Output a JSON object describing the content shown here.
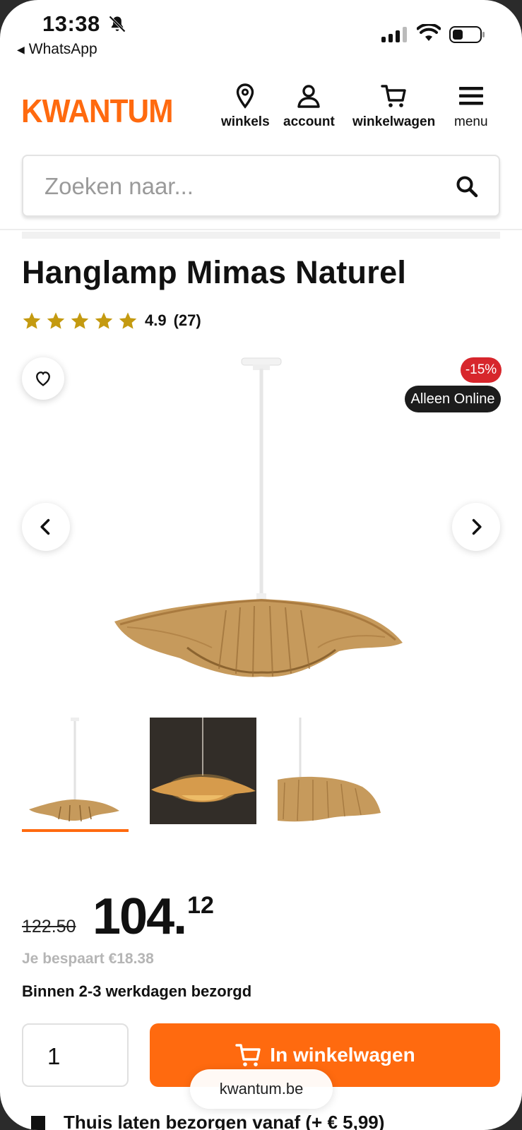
{
  "status_bar": {
    "time": "13:38",
    "back_app": "WhatsApp",
    "icons": [
      "bell-off-icon",
      "signal-icon",
      "wifi-icon",
      "battery-icon"
    ]
  },
  "header": {
    "logo": "KWANTUM",
    "nav": [
      {
        "label": "winkels",
        "icon": "location-pin-icon"
      },
      {
        "label": "account",
        "icon": "user-icon"
      },
      {
        "label": "winkelwagen",
        "icon": "cart-icon"
      },
      {
        "label": "menu",
        "icon": "hamburger-icon"
      }
    ]
  },
  "search": {
    "placeholder": "Zoeken naar..."
  },
  "product": {
    "title": "Hanglamp Mimas Naturel",
    "rating": {
      "score": "4.9",
      "count": "(27)",
      "stars": 5
    },
    "badges": {
      "discount": "-15%",
      "online": "Alleen Online"
    },
    "thumbnails": 3,
    "active_thumbnail": 0
  },
  "pricing": {
    "old_price": "122.50",
    "price_main": "104.",
    "price_cents": "12",
    "savings": "Je bespaart €18.38",
    "delivery": "Binnen 2-3 werkdagen bezorgd"
  },
  "purchase": {
    "quantity": "1",
    "cart_button": "In winkelwagen",
    "home_delivery": "Thuis laten bezorgen vanaf (+ € 5,99)"
  },
  "browser": {
    "url": "kwantum.be"
  },
  "colors": {
    "brand": "#ff6a0f",
    "star": "#c49a10",
    "discount": "#d7262c"
  }
}
